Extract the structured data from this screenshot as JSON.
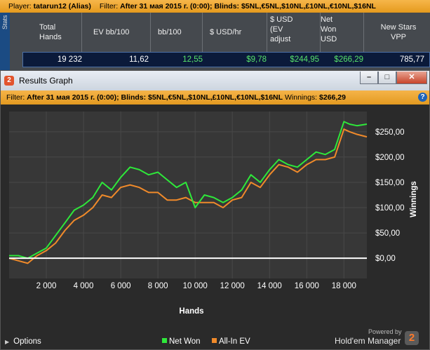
{
  "top_filter": {
    "player_label": "Player:",
    "player": "tatarun12 (Alias)",
    "filter_label": "Filter:",
    "filter": "After 31 мая 2015 г. (0:00); Blinds: $5NL,€5NL,$10NL,£10NL,€10NL,$16NL"
  },
  "stats": {
    "tab_label": "Stats",
    "columns": [
      {
        "label": "Total\nHands"
      },
      {
        "label": "EV bb/100"
      },
      {
        "label": "bb/100"
      },
      {
        "label": "$ USD/hr"
      },
      {
        "label": "$ USD\n(EV\nadjust"
      },
      {
        "label": "Net\nWon\nUSD"
      },
      {
        "label": "New Stars\nVPP"
      }
    ],
    "row": [
      "19 232",
      "11,62",
      "12,55",
      "$9,78",
      "$244,95",
      "$266,29",
      "785,77"
    ],
    "colors": {
      "white": "#ffffff",
      "green": "#57e36b"
    }
  },
  "window": {
    "title": "Results Graph",
    "app_icon": "hm2-icon",
    "minimize": "–",
    "maximize": "□",
    "close": "✕"
  },
  "graph_filter": {
    "filter_label": "Filter:",
    "filter": "After 31 мая 2015 г. (0:00); Blinds: $5NL,€5NL,$10NL,£10NL,€10NL,$16NL",
    "winnings_label": "Winnings:",
    "winnings": "$266,29"
  },
  "chart_data": {
    "type": "line",
    "xlabel": "Hands",
    "ylabel": "Winnings",
    "xlim": [
      0,
      19232
    ],
    "ylim": [
      -40,
      290
    ],
    "x_ticks": [
      2000,
      4000,
      6000,
      8000,
      10000,
      12000,
      14000,
      16000,
      18000
    ],
    "x_tick_labels": [
      "2 000",
      "4 000",
      "6 000",
      "8 000",
      "10 000",
      "12 000",
      "14 000",
      "16 000",
      "18 000"
    ],
    "y_ticks": [
      0,
      50,
      100,
      150,
      200,
      250
    ],
    "y_tick_labels": [
      "$0,00",
      "$50,00",
      "$100,00",
      "$150,00",
      "$200,00",
      "$250,00"
    ],
    "grid": true,
    "legend_position": "bottom",
    "x": [
      0,
      500,
      1000,
      1500,
      2000,
      2500,
      3000,
      3500,
      4000,
      4500,
      5000,
      5500,
      6000,
      6500,
      7000,
      7500,
      8000,
      8500,
      9000,
      9500,
      10000,
      10500,
      11000,
      11500,
      12000,
      12500,
      13000,
      13500,
      14000,
      14500,
      15000,
      15500,
      16000,
      16500,
      17000,
      17500,
      18000,
      18300,
      18700,
      19232
    ],
    "series": [
      {
        "name": "Net Won",
        "color": "#2ee83a",
        "values": [
          5,
          5,
          0,
          10,
          20,
          45,
          70,
          95,
          105,
          120,
          150,
          135,
          160,
          180,
          175,
          165,
          170,
          155,
          140,
          150,
          100,
          125,
          120,
          110,
          120,
          135,
          165,
          150,
          175,
          195,
          185,
          180,
          195,
          210,
          205,
          215,
          270,
          265,
          262,
          265
        ]
      },
      {
        "name": "All-In EV",
        "color": "#f08a2a",
        "values": [
          0,
          -5,
          -10,
          5,
          15,
          30,
          55,
          75,
          85,
          100,
          125,
          120,
          140,
          145,
          140,
          130,
          130,
          115,
          115,
          120,
          110,
          110,
          110,
          100,
          115,
          120,
          150,
          140,
          165,
          185,
          180,
          170,
          185,
          195,
          195,
          200,
          255,
          250,
          245,
          240
        ]
      }
    ],
    "baseline": 0
  },
  "footer": {
    "options_label": "Options",
    "powered_by": "Powered by",
    "brand": "Hold'em Manager",
    "brand_badge": "2"
  }
}
